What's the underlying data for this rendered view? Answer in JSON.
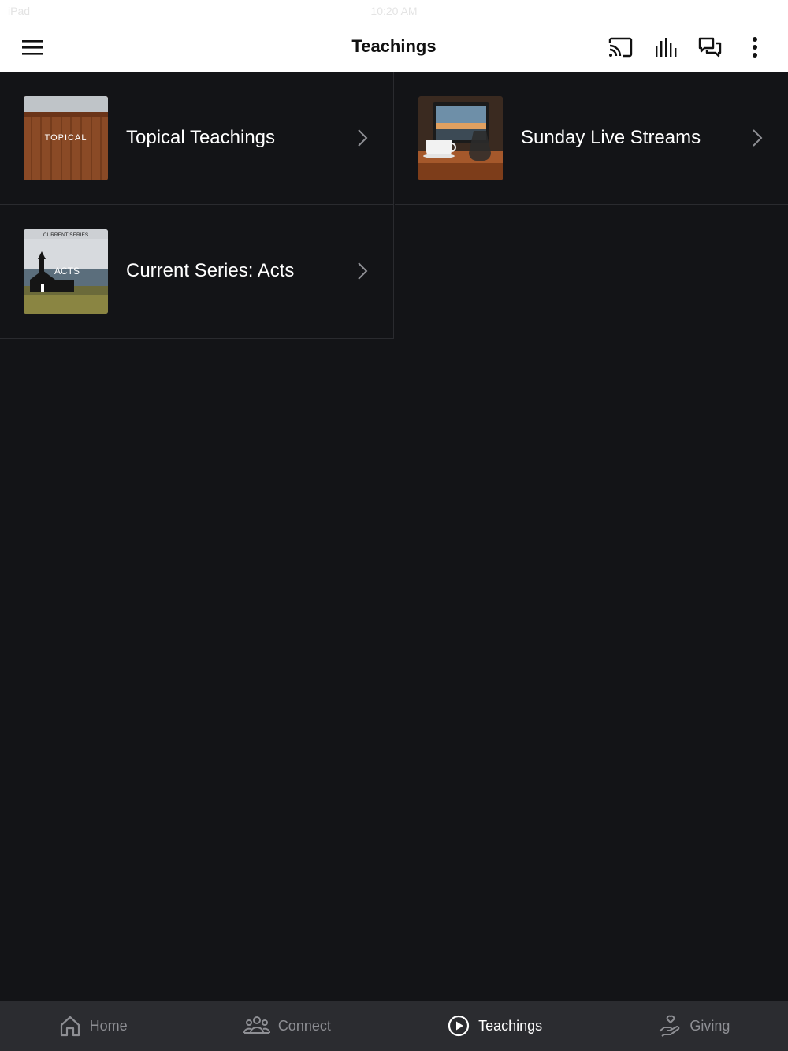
{
  "status_bar": {
    "carrier": "iPad",
    "time": "10:20 AM"
  },
  "header": {
    "title": "Teachings",
    "icons": [
      "menu-icon",
      "cast-icon",
      "bar-chart-icon",
      "chat-icon",
      "more-vert-icon"
    ]
  },
  "items": [
    {
      "label": "Topical Teachings",
      "thumb_text": "TOPICAL"
    },
    {
      "label": "Sunday Live Streams",
      "thumb_text": ""
    },
    {
      "label": "Current Series: Acts",
      "thumb_caption": "CURRENT SERIES",
      "thumb_text": "ACTS"
    }
  ],
  "tabs": [
    {
      "label": "Home",
      "icon": "home-icon",
      "active": false
    },
    {
      "label": "Connect",
      "icon": "people-icon",
      "active": false
    },
    {
      "label": "Teachings",
      "icon": "play-circle-icon",
      "active": true
    },
    {
      "label": "Giving",
      "icon": "giving-hand-icon",
      "active": false
    }
  ],
  "colors": {
    "background": "#131417",
    "header": "#ffffff",
    "tab_bar": "#2b2c30",
    "tab_inactive": "#8e8f94",
    "tab_active": "#ffffff"
  }
}
